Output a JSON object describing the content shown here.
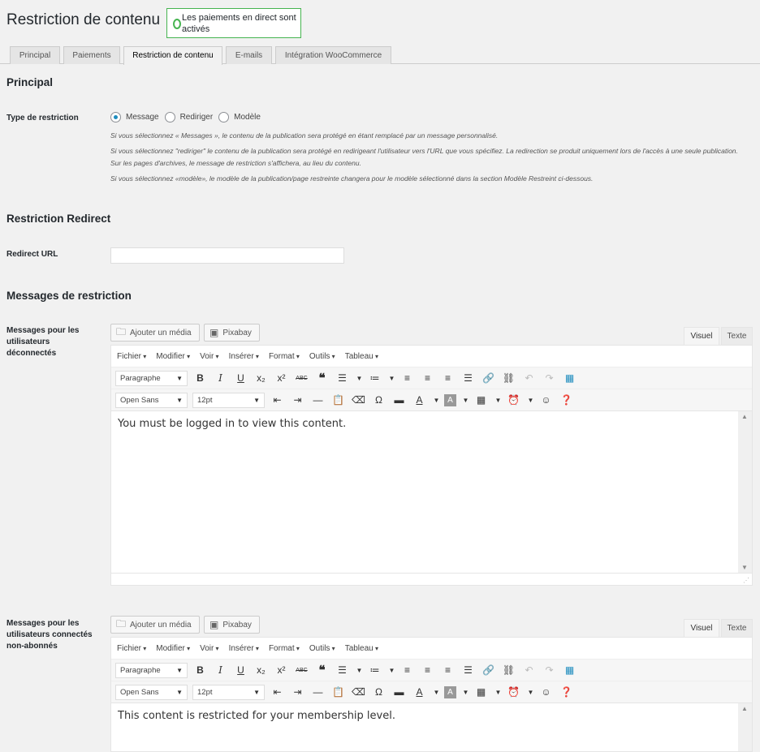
{
  "page": {
    "title": "Restriction de contenu"
  },
  "notice": {
    "text": "Les paiements en direct sont activés"
  },
  "tabs": [
    {
      "label": "Principal"
    },
    {
      "label": "Paiements"
    },
    {
      "label": "Restriction de contenu",
      "active": true
    },
    {
      "label": "E-mails"
    },
    {
      "label": "Intégration WooCommerce"
    }
  ],
  "sections": {
    "principal": "Principal",
    "redirect": "Restriction Redirect",
    "messages": "Messages de restriction"
  },
  "restriction_type": {
    "label": "Type de restriction",
    "options": [
      "Message",
      "Rediriger",
      "Modèle"
    ],
    "selected": "Message",
    "descriptions": [
      "Si vous sélectionnez « Messages », le contenu de la publication sera protégé en étant remplacé par un message personnalisé.",
      "Si vous sélectionnez \"rediriger\" le contenu de la publication sera protégé en redirigeant l'utilisateur vers l'URL que vous spécifiez. La redirection se produit uniquement lors de l'accès à une seule publication. Sur les pages d'archives, le message de restriction s'affichera, au lieu du contenu.",
      "Si vous sélectionnez «modèle», le modèle de la publication/page restreinte changera pour le modèle sélectionné dans la section Modèle Restreint ci-dessous."
    ]
  },
  "redirect_url": {
    "label": "Redirect URL",
    "value": "",
    "placeholder": ""
  },
  "editor_ui": {
    "add_media": "Ajouter un média",
    "pixabay": "Pixabay",
    "visual_tab": "Visuel",
    "text_tab": "Texte",
    "menu": [
      "Fichier",
      "Modifier",
      "Voir",
      "Insérer",
      "Format",
      "Outils",
      "Tableau"
    ],
    "block_format": "Paragraphe",
    "font_family": "Open Sans",
    "font_size": "12pt"
  },
  "editors": [
    {
      "label": "Messages pour les utilisateurs déconnectés",
      "content": "You must be logged in to view this content."
    },
    {
      "label": "Messages pour les utilisateurs connectés non-abonnés",
      "content": "This content is restricted for your membership level."
    }
  ],
  "colors": {
    "accent": "#1e8cbe",
    "notice_border": "#46b450",
    "background": "#f1f1f1"
  }
}
